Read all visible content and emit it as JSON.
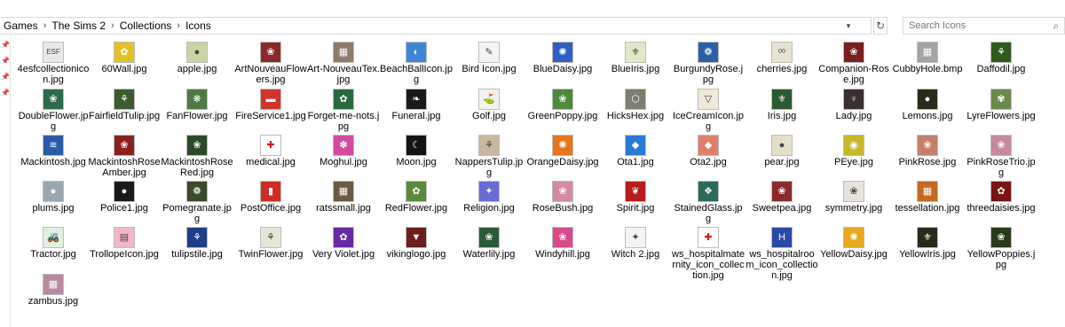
{
  "breadcrumb": [
    "Games",
    "The Sims 2",
    "Collections",
    "Icons"
  ],
  "search": {
    "placeholder": "Search Icons"
  },
  "items": [
    {
      "name": "4esfcollectionicon.jpg",
      "color": "#e8e8e8",
      "glyph": "ESF"
    },
    {
      "name": "60Wall.jpg",
      "color": "#e2c226",
      "glyph": "✿"
    },
    {
      "name": "apple.jpg",
      "color": "#c8d6a4",
      "glyph": "●"
    },
    {
      "name": "ArtNouveauFlowers.jpg",
      "color": "#8a2a2a",
      "glyph": "❀"
    },
    {
      "name": "Art-NouveauTex.jpg",
      "color": "#8c7a6a",
      "glyph": "▦"
    },
    {
      "name": "BeachBallIcon.jpg",
      "color": "#3d86d6",
      "glyph": "◐"
    },
    {
      "name": "Bird Icon.jpg",
      "color": "#f4f4f4",
      "glyph": "✎"
    },
    {
      "name": "BlueDaisy.jpg",
      "color": "#2f5fc4",
      "glyph": "✺"
    },
    {
      "name": "BlueIris.jpg",
      "color": "#dfe9c6",
      "glyph": "⚜"
    },
    {
      "name": "BurgundyRose.jpg",
      "color": "#2b5ea8",
      "glyph": "❁"
    },
    {
      "name": "cherries.jpg",
      "color": "#e8e2d2",
      "glyph": "ᵒᵒ"
    },
    {
      "name": "Companion-Rose.jpg",
      "color": "#7a1f1f",
      "glyph": "❀"
    },
    {
      "name": "CubbyHole.bmp",
      "color": "#a4a4a4",
      "glyph": "▦"
    },
    {
      "name": "Daffodil.jpg",
      "color": "#2e5a1e",
      "glyph": "⚘"
    },
    {
      "name": "DoubleFlower.jpg",
      "color": "#2d6a4a",
      "glyph": "❀"
    },
    {
      "name": "FairfieldTulip.jpg",
      "color": "#3b5d2c",
      "glyph": "⚘"
    },
    {
      "name": "FanFlower.jpg",
      "color": "#4f7a45",
      "glyph": "❋"
    },
    {
      "name": "FireService1.jpg",
      "color": "#d2332a",
      "glyph": "▬"
    },
    {
      "name": "Forget-me-nots.jpg",
      "color": "#2a6a40",
      "glyph": "✿"
    },
    {
      "name": "Funeral.jpg",
      "color": "#1a1a1a",
      "glyph": "❧"
    },
    {
      "name": "Golf.jpg",
      "color": "#f2f2f2",
      "glyph": "⛳"
    },
    {
      "name": "GreenPoppy.jpg",
      "color": "#4f8a3a",
      "glyph": "❀"
    },
    {
      "name": "HicksHex.jpg",
      "color": "#7d7d70",
      "glyph": "⬡"
    },
    {
      "name": "IceCreamIcon.jpg",
      "color": "#f0e8d8",
      "glyph": "▽"
    },
    {
      "name": "Iris.jpg",
      "color": "#2c5a30",
      "glyph": "⚜"
    },
    {
      "name": "Lady.jpg",
      "color": "#3a3030",
      "glyph": "♀"
    },
    {
      "name": "Lemons.jpg",
      "color": "#2a2a1a",
      "glyph": "●"
    },
    {
      "name": "LyreFlowers.jpg",
      "color": "#6a8a4a",
      "glyph": "✾"
    },
    {
      "name": "Mackintosh.jpg",
      "color": "#2a5aa8",
      "glyph": "≋"
    },
    {
      "name": "MackintoshRoseAmber.jpg",
      "color": "#8a2020",
      "glyph": "❀"
    },
    {
      "name": "MackintoshRoseRed.jpg",
      "color": "#2a4a2a",
      "glyph": "❀"
    },
    {
      "name": "medical.jpg",
      "color": "#ffffff",
      "glyph": "✚"
    },
    {
      "name": "Moghul.jpg",
      "color": "#d44aa0",
      "glyph": "✽"
    },
    {
      "name": "Moon.jpg",
      "color": "#141414",
      "glyph": "☾"
    },
    {
      "name": "NappersTulip.jpg",
      "color": "#c9b7a0",
      "glyph": "⚘"
    },
    {
      "name": "OrangeDaisy.jpg",
      "color": "#e8751c",
      "glyph": "✺"
    },
    {
      "name": "Ota1.jpg",
      "color": "#2a7ad4",
      "glyph": "◆"
    },
    {
      "name": "Ota2.jpg",
      "color": "#e0806a",
      "glyph": "◆"
    },
    {
      "name": "pear.jpg",
      "color": "#e4e0c8",
      "glyph": "●"
    },
    {
      "name": "PEye.jpg",
      "color": "#c6b82a",
      "glyph": "◉"
    },
    {
      "name": "PinkRose.jpg",
      "color": "#c4806a",
      "glyph": "❀"
    },
    {
      "name": "PinkRoseTrio.jpg",
      "color": "#c58aa0",
      "glyph": "❀"
    },
    {
      "name": "plums.jpg",
      "color": "#9aa6b0",
      "glyph": "●"
    },
    {
      "name": "Police1.jpg",
      "color": "#1a1a1a",
      "glyph": "●"
    },
    {
      "name": "Pomegranate.jpg",
      "color": "#3a4a2a",
      "glyph": "❁"
    },
    {
      "name": "PostOffice.jpg",
      "color": "#d22a24",
      "glyph": "▮"
    },
    {
      "name": "ratssmall.jpg",
      "color": "#6a5a40",
      "glyph": "▦"
    },
    {
      "name": "RedFlower.jpg",
      "color": "#5a8a3a",
      "glyph": "✿"
    },
    {
      "name": "Religion.jpg",
      "color": "#6a6ad4",
      "glyph": "✦"
    },
    {
      "name": "RoseBush.jpg",
      "color": "#d48aa0",
      "glyph": "❀"
    },
    {
      "name": "Spirit.jpg",
      "color": "#b81c1c",
      "glyph": "❦"
    },
    {
      "name": "StainedGlass.jpg",
      "color": "#2a6a5a",
      "glyph": "❖"
    },
    {
      "name": "Sweetpea.jpg",
      "color": "#8a2a2a",
      "glyph": "❀"
    },
    {
      "name": "symmetry.jpg",
      "color": "#e6e2dc",
      "glyph": "❀"
    },
    {
      "name": "tessellation.jpg",
      "color": "#c46a20",
      "glyph": "▦"
    },
    {
      "name": "threedaisies.jpg",
      "color": "#7a1414",
      "glyph": "✿"
    },
    {
      "name": "Tractor.jpg",
      "color": "#e0f0e0",
      "glyph": "🚜"
    },
    {
      "name": "TrollopeIcon.jpg",
      "color": "#f2b8c8",
      "glyph": "▤"
    },
    {
      "name": "tulipstile.jpg",
      "color": "#1e3e8a",
      "glyph": "⚘"
    },
    {
      "name": "TwinFlower.jpg",
      "color": "#e6e6d6",
      "glyph": "⚘"
    },
    {
      "name": "Very Violet.jpg",
      "color": "#6a2aa4",
      "glyph": "✿"
    },
    {
      "name": "vikinglogo.jpg",
      "color": "#6a1e1e",
      "glyph": "▼"
    },
    {
      "name": "Waterlily.jpg",
      "color": "#2a5a3a",
      "glyph": "❀"
    },
    {
      "name": "Windyhill.jpg",
      "color": "#d84a8a",
      "glyph": "❀"
    },
    {
      "name": "Witch 2.jpg",
      "color": "#f4f4f4",
      "glyph": "✦"
    },
    {
      "name": "ws_hospitalmaternity_icon_collection.jpg",
      "color": "#ffffff",
      "glyph": "✚"
    },
    {
      "name": "ws_hospitalroom_icon_collection.jpg",
      "color": "#2a4aa8",
      "glyph": "H"
    },
    {
      "name": "YellowDaisy.jpg",
      "color": "#e8a81c",
      "glyph": "✺"
    },
    {
      "name": "YellowIris.jpg",
      "color": "#2a2a1a",
      "glyph": "⚜"
    },
    {
      "name": "YellowPoppies.jpg",
      "color": "#2a3a1a",
      "glyph": "❀"
    },
    {
      "name": "zambus.jpg",
      "color": "#b88aa0",
      "glyph": "▦"
    }
  ]
}
